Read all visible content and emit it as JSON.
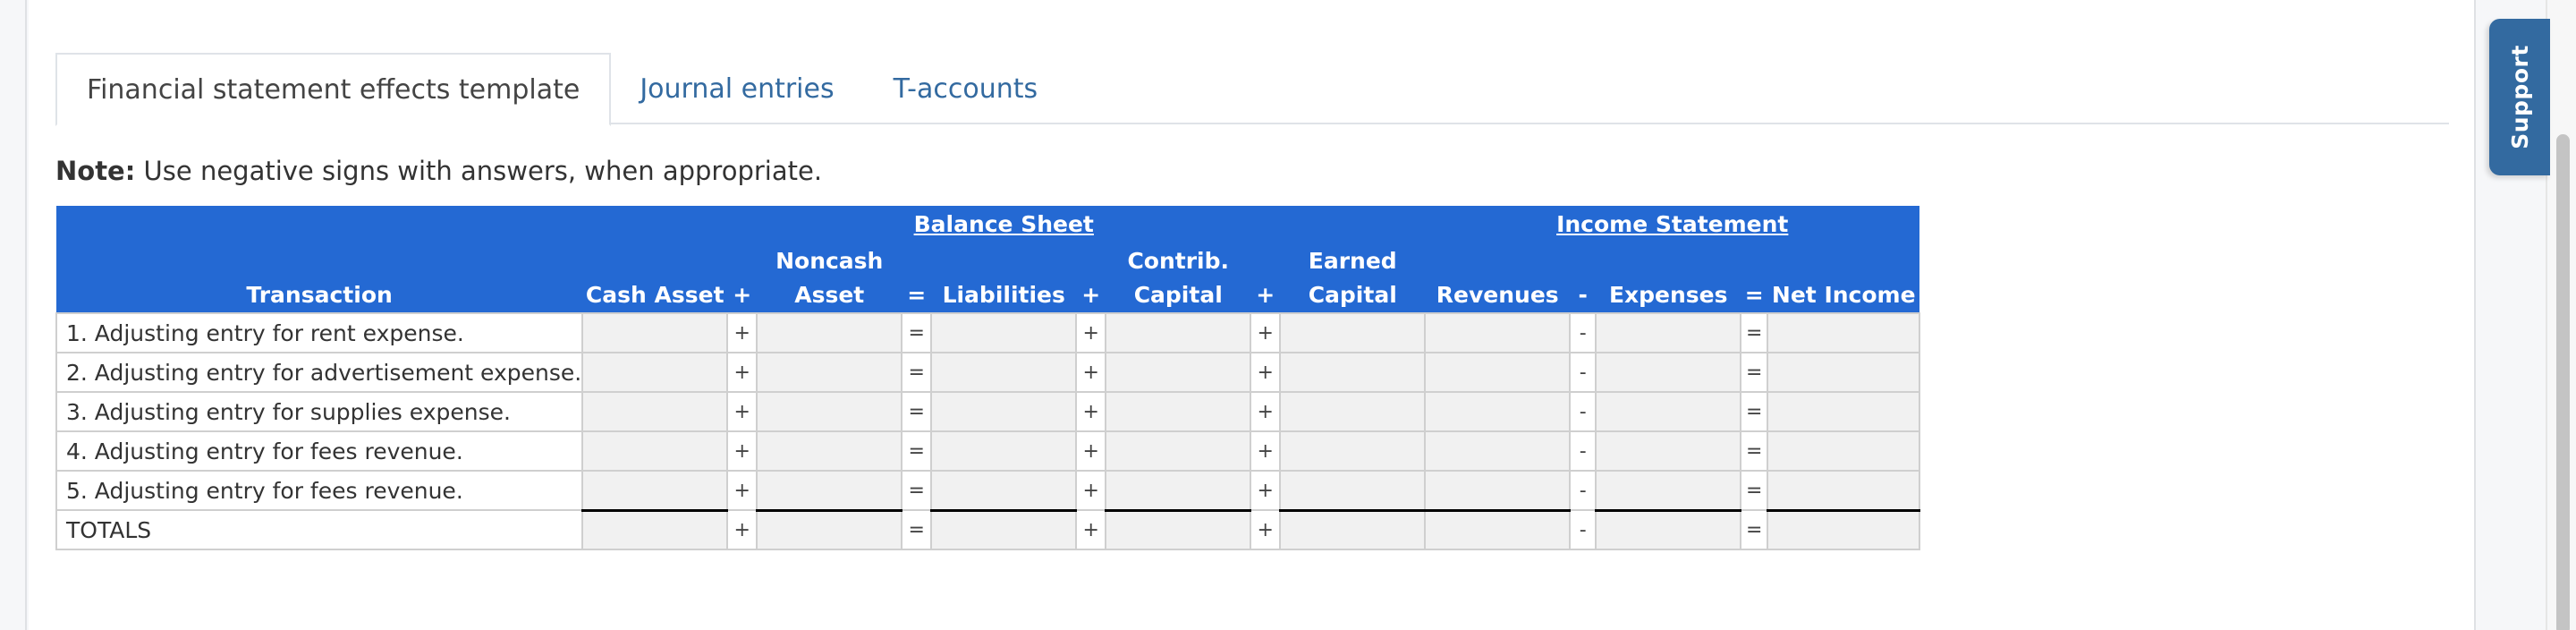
{
  "tabs": [
    {
      "label": "Financial statement effects template",
      "active": true
    },
    {
      "label": "Journal entries",
      "active": false
    },
    {
      "label": "T-accounts",
      "active": false
    }
  ],
  "note": {
    "bold": "Note:",
    "text": " Use negative signs with answers, when appropriate."
  },
  "support_label": "Support",
  "table": {
    "groups": {
      "balance_sheet": "Balance Sheet",
      "income_statement": "Income Statement"
    },
    "headers": {
      "transaction": "Transaction",
      "cash_asset": "Cash Asset",
      "noncash_asset_1": "Noncash",
      "noncash_asset_2": "Asset",
      "liabilities": "Liabilities",
      "contrib_capital_1": "Contrib.",
      "contrib_capital_2": "Capital",
      "earned_capital_1": "Earned",
      "earned_capital_2": "Capital",
      "revenues": "Revenues",
      "expenses": "Expenses",
      "net_income": "Net Income"
    },
    "operators": {
      "plus": "+",
      "equals": "=",
      "minus": "-"
    },
    "rows": [
      {
        "label": "1. Adjusting entry for rent expense.",
        "values": [
          "",
          "",
          "",
          "",
          "",
          "",
          "",
          ""
        ]
      },
      {
        "label": "2. Adjusting entry for advertisement expense.",
        "values": [
          "",
          "",
          "",
          "",
          "",
          "",
          "",
          ""
        ]
      },
      {
        "label": "3. Adjusting entry for supplies expense.",
        "values": [
          "",
          "",
          "",
          "",
          "",
          "",
          "",
          ""
        ]
      },
      {
        "label": "4. Adjusting entry for fees revenue.",
        "values": [
          "",
          "",
          "",
          "",
          "",
          "",
          "",
          ""
        ]
      },
      {
        "label": "5. Adjusting entry for fees revenue.",
        "values": [
          "",
          "",
          "",
          "",
          "",
          "",
          "",
          ""
        ]
      },
      {
        "label": "TOTALS",
        "values": [
          "",
          "",
          "",
          "",
          "",
          "",
          "",
          ""
        ]
      }
    ]
  },
  "colors": {
    "header_bg": "#2469d3",
    "link": "#336aa0",
    "support_bg": "#336aa0",
    "input_bg": "#f1f1f1"
  }
}
